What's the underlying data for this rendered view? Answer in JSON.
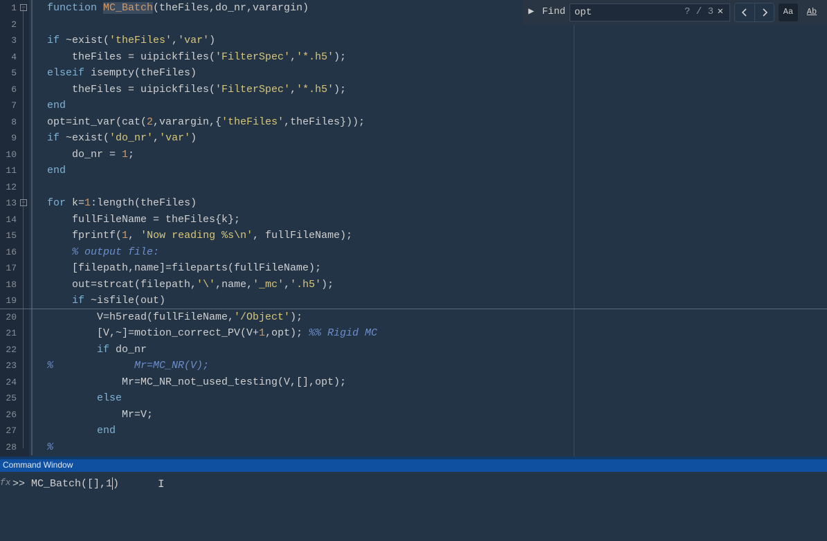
{
  "find": {
    "toggle_icon": "▶",
    "label": "Find",
    "query": "opt",
    "match_count": "? / 3",
    "close": "✕",
    "prev": "‹",
    "next": "›",
    "match_case": "Aa",
    "whole_word": "Ab"
  },
  "command_window": {
    "header": "Command Window",
    "fx_label": "fx",
    "prompt": ">> ",
    "input": "MC_Batch([],1)"
  },
  "lines": [
    {
      "n": 1,
      "fold": "−",
      "seg": true,
      "tokens": [
        {
          "t": "function ",
          "c": "kw"
        },
        {
          "t": "MC_Batch",
          "c": "fn sel"
        },
        {
          "t": "(theFiles,do_nr,varargin)",
          "c": "id"
        }
      ]
    },
    {
      "n": 2,
      "seg": true,
      "tokens": []
    },
    {
      "n": 3,
      "seg": true,
      "tokens": [
        {
          "t": "if ",
          "c": "kw"
        },
        {
          "t": "~exist(",
          "c": "id"
        },
        {
          "t": "'theFiles'",
          "c": "str"
        },
        {
          "t": ",",
          "c": "id"
        },
        {
          "t": "'var'",
          "c": "str"
        },
        {
          "t": ")",
          "c": "id"
        }
      ]
    },
    {
      "n": 4,
      "seg": true,
      "tokens": [
        {
          "t": "    theFiles = uipickfiles(",
          "c": "id"
        },
        {
          "t": "'FilterSpec'",
          "c": "str"
        },
        {
          "t": ",",
          "c": "id"
        },
        {
          "t": "'*.h5'",
          "c": "str"
        },
        {
          "t": ");",
          "c": "id"
        }
      ]
    },
    {
      "n": 5,
      "seg": true,
      "tokens": [
        {
          "t": "elseif ",
          "c": "kw"
        },
        {
          "t": "isempty(theFiles)",
          "c": "id"
        }
      ]
    },
    {
      "n": 6,
      "seg": true,
      "tokens": [
        {
          "t": "    theFiles = uipickfiles(",
          "c": "id"
        },
        {
          "t": "'FilterSpec'",
          "c": "str"
        },
        {
          "t": ",",
          "c": "id"
        },
        {
          "t": "'*.h5'",
          "c": "str"
        },
        {
          "t": ");",
          "c": "id"
        }
      ]
    },
    {
      "n": 7,
      "seg": true,
      "tokens": [
        {
          "t": "end",
          "c": "kw"
        }
      ]
    },
    {
      "n": 8,
      "seg": true,
      "tokens": [
        {
          "t": "opt=int_var(cat(",
          "c": "id"
        },
        {
          "t": "2",
          "c": "num"
        },
        {
          "t": ",varargin,{",
          "c": "id"
        },
        {
          "t": "'theFiles'",
          "c": "str"
        },
        {
          "t": ",theFiles}));",
          "c": "id"
        }
      ]
    },
    {
      "n": 9,
      "seg": true,
      "tokens": [
        {
          "t": "if ",
          "c": "kw"
        },
        {
          "t": "~exist(",
          "c": "id"
        },
        {
          "t": "'do_nr'",
          "c": "str"
        },
        {
          "t": ",",
          "c": "id"
        },
        {
          "t": "'var'",
          "c": "str"
        },
        {
          "t": ")",
          "c": "id"
        }
      ]
    },
    {
      "n": 10,
      "seg": true,
      "tokens": [
        {
          "t": "    do_nr = ",
          "c": "id"
        },
        {
          "t": "1",
          "c": "num"
        },
        {
          "t": ";",
          "c": "id"
        }
      ]
    },
    {
      "n": 11,
      "seg": true,
      "tokens": [
        {
          "t": "end",
          "c": "kw"
        }
      ]
    },
    {
      "n": 12,
      "seg": true,
      "tokens": []
    },
    {
      "n": 13,
      "fold": "−",
      "seg": true,
      "tokens": [
        {
          "t": "for ",
          "c": "kw"
        },
        {
          "t": "k=",
          "c": "id"
        },
        {
          "t": "1",
          "c": "num"
        },
        {
          "t": ":length(theFiles)",
          "c": "id"
        }
      ]
    },
    {
      "n": 14,
      "seg": true,
      "tokens": [
        {
          "t": "    fullFileName = theFiles{k};",
          "c": "id"
        }
      ]
    },
    {
      "n": 15,
      "seg": true,
      "tokens": [
        {
          "t": "    fprintf(",
          "c": "id"
        },
        {
          "t": "1",
          "c": "num"
        },
        {
          "t": ", ",
          "c": "id"
        },
        {
          "t": "'Now reading %s\\n'",
          "c": "str"
        },
        {
          "t": ", fullFileName);",
          "c": "id"
        }
      ]
    },
    {
      "n": 16,
      "seg": true,
      "tokens": [
        {
          "t": "    ",
          "c": "id"
        },
        {
          "t": "% output file:",
          "c": "cm"
        }
      ]
    },
    {
      "n": 17,
      "seg": true,
      "tokens": [
        {
          "t": "    [filepath,name]=fileparts(fullFileName);",
          "c": "id"
        }
      ]
    },
    {
      "n": 18,
      "seg": true,
      "tokens": [
        {
          "t": "    out=strcat(filepath,",
          "c": "id"
        },
        {
          "t": "'\\\\'",
          "c": "str"
        },
        {
          "t": ",name,",
          "c": "id"
        },
        {
          "t": "'_mc'",
          "c": "str"
        },
        {
          "t": ",",
          "c": "id"
        },
        {
          "t": "'.h5'",
          "c": "str"
        },
        {
          "t": ");",
          "c": "id"
        }
      ]
    },
    {
      "n": 19,
      "seg": true,
      "tokens": [
        {
          "t": "    ",
          "c": "id"
        },
        {
          "t": "if ",
          "c": "kw"
        },
        {
          "t": "~isfile(out)",
          "c": "id"
        }
      ]
    },
    {
      "n": 20,
      "seg": true,
      "tokens": [
        {
          "t": "        V=h5read(fullFileName,",
          "c": "id"
        },
        {
          "t": "'/Object'",
          "c": "str"
        },
        {
          "t": ");",
          "c": "id"
        }
      ]
    },
    {
      "n": 21,
      "seg": true,
      "tokens": [
        {
          "t": "        [V,~]=motion_correct_PV(V+",
          "c": "id"
        },
        {
          "t": "1",
          "c": "num"
        },
        {
          "t": ",opt); ",
          "c": "id"
        },
        {
          "t": "%% Rigid MC",
          "c": "cm"
        }
      ]
    },
    {
      "n": 22,
      "seg": true,
      "tokens": [
        {
          "t": "        ",
          "c": "id"
        },
        {
          "t": "if ",
          "c": "kw"
        },
        {
          "t": "do_nr",
          "c": "id"
        }
      ]
    },
    {
      "n": 23,
      "seg": true,
      "tokens": [
        {
          "t": "%             Mr=MC_NR(V);",
          "c": "cm"
        }
      ]
    },
    {
      "n": 24,
      "seg": true,
      "tokens": [
        {
          "t": "            Mr=MC_NR_not_used_testing(V,[],opt);",
          "c": "id"
        }
      ]
    },
    {
      "n": 25,
      "seg": true,
      "tokens": [
        {
          "t": "        ",
          "c": "id"
        },
        {
          "t": "else",
          "c": "kw"
        }
      ]
    },
    {
      "n": 26,
      "seg": true,
      "tokens": [
        {
          "t": "            Mr=V;",
          "c": "id"
        }
      ]
    },
    {
      "n": 27,
      "seg": true,
      "tokens": [
        {
          "t": "        ",
          "c": "id"
        },
        {
          "t": "end",
          "c": "kw"
        }
      ]
    },
    {
      "n": 28,
      "seg": true,
      "tokens": [
        {
          "t": "%",
          "c": "cm"
        }
      ]
    }
  ]
}
